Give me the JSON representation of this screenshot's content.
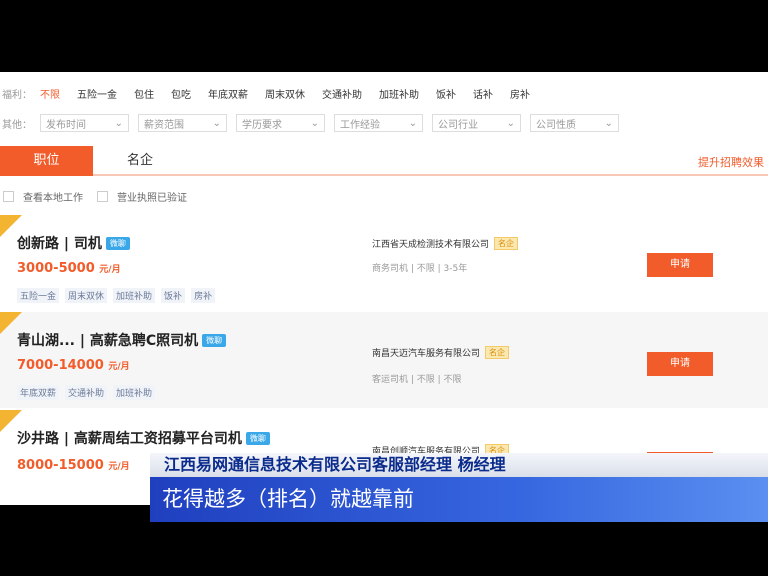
{
  "filters": {
    "benefit_label": "福利：",
    "benefits": [
      "不限",
      "五险一金",
      "包住",
      "包吃",
      "年底双薪",
      "周末双休",
      "交通补助",
      "加班补助",
      "饭补",
      "话补",
      "房补"
    ],
    "other_label": "其他：",
    "selects": [
      "发布时间",
      "薪资范围",
      "学历要求",
      "工作经验",
      "公司行业",
      "公司性质"
    ]
  },
  "tabs": [
    "职位",
    "名企"
  ],
  "promo": "提升招聘效果",
  "checks": [
    "查看本地工作",
    "营业执照已验证"
  ],
  "chat_label": "微聊",
  "famous_badge": "名企",
  "apply_label": "申请",
  "jobs": [
    {
      "title": "创新路 | 司机",
      "salary": "3000-5000",
      "unit": "元/月",
      "tags": [
        "五险一金",
        "周末双休",
        "加班补助",
        "饭补",
        "房补"
      ],
      "company": "江西省天成检测技术有限公司",
      "meta": "商务司机 | 不限 | 3-5年"
    },
    {
      "title": "青山湖... | 高薪急聘C照司机",
      "salary": "7000-14000",
      "unit": "元/月",
      "tags": [
        "年底双薪",
        "交通补助",
        "加班补助"
      ],
      "company": "南昌天迈汽车服务有限公司",
      "meta": "客运司机 | 不限 | 不限"
    },
    {
      "title": "沙井路 | 高薪周结工资招募平台司机",
      "salary": "8000-15000",
      "unit": "元/月",
      "tags": [],
      "company": "南昌创顺汽车服务有限公司",
      "meta": ""
    }
  ],
  "caption": {
    "speaker": "江西易网通信息技术有限公司客服部经理  杨经理",
    "quote": "花得越多（排名）就越靠前"
  }
}
